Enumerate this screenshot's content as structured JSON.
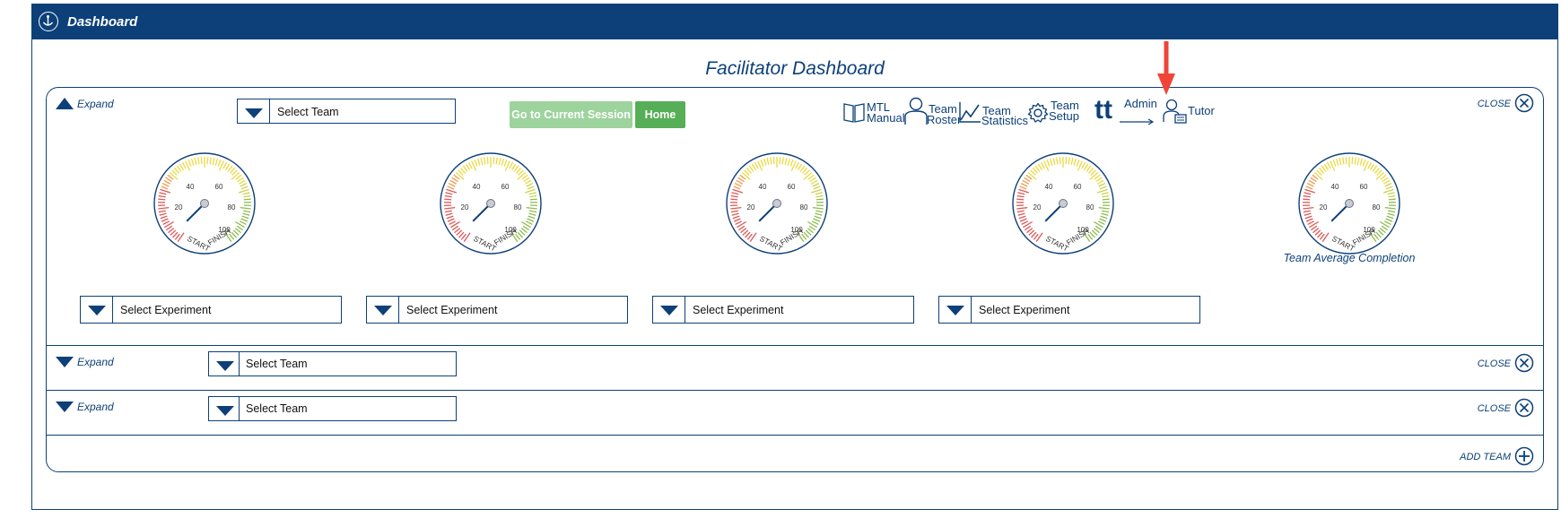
{
  "window": {
    "title": "Dashboard",
    "logo_icon": "compass-logo-icon"
  },
  "page": {
    "title": "Facilitator Dashboard"
  },
  "colors": {
    "brand": "#0d4078",
    "current_session": "#9dd39c",
    "home": "#56ae56",
    "annotation_arrow": "#f04438"
  },
  "team_panels": [
    {
      "expand_label": "Expand",
      "expanded": true,
      "team_select": "Select Team",
      "buttons": {
        "current_session": "Go to Current Session",
        "home": "Home"
      },
      "tools": [
        {
          "icon": "book-icon",
          "label1": "MTL",
          "label2": "Manual"
        },
        {
          "icon": "person-icon",
          "label1": "Team",
          "label2": "Roster"
        },
        {
          "icon": "line-chart-icon",
          "label1": "Team",
          "label2": "Statistics"
        },
        {
          "icon": "gear-icon",
          "label1": "Team",
          "label2": "Setup"
        },
        {
          "icon": "tt-logo-icon",
          "label1": "Admin",
          "label2": ""
        },
        {
          "icon": "tutor-icon",
          "label1": "Tutor",
          "label2": ""
        }
      ],
      "close_label": "CLOSE",
      "gauges": [
        {
          "scale": [
            "20",
            "40",
            "60",
            "80",
            "100"
          ],
          "start": "START",
          "finish": "FINISH",
          "experiment_select": "Select Experiment"
        },
        {
          "scale": [
            "20",
            "40",
            "60",
            "80",
            "100"
          ],
          "start": "START",
          "finish": "FINISH",
          "experiment_select": "Select Experiment"
        },
        {
          "scale": [
            "20",
            "40",
            "60",
            "80",
            "100"
          ],
          "start": "START",
          "finish": "FINISH",
          "experiment_select": "Select Experiment"
        },
        {
          "scale": [
            "20",
            "40",
            "60",
            "80",
            "100"
          ],
          "start": "START",
          "finish": "FINISH",
          "experiment_select": "Select Experiment"
        },
        {
          "scale": [
            "20",
            "40",
            "60",
            "80",
            "100"
          ],
          "start": "START",
          "finish": "FINISH",
          "caption": "Team Average Completion"
        }
      ]
    },
    {
      "expand_label": "Expand",
      "expanded": false,
      "team_select": "Select Team",
      "close_label": "CLOSE"
    },
    {
      "expand_label": "Expand",
      "expanded": false,
      "team_select": "Select Team",
      "close_label": "CLOSE"
    }
  ],
  "add_team_label": "ADD TEAM"
}
